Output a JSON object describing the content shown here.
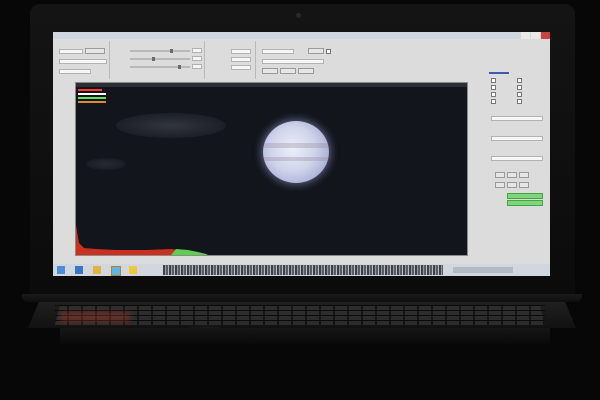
{
  "app": {
    "title": "",
    "window_controls": [
      "minimize",
      "maximize",
      "close"
    ]
  },
  "colors": {
    "stats_red": "#ff3a2a",
    "stats_white": "#ffffff",
    "stats_green": "#5ee35a",
    "histogram_red": "#c9301f",
    "histogram_green": "#5fcf4f",
    "planet": "#cfd4ea",
    "accent_button": "#7ed67a"
  },
  "viewer": {
    "subject": "planet-jupiter"
  },
  "taskbar": {
    "icons": [
      "start-icon",
      "explorer-icon",
      "folder-icon",
      "capture-app-icon",
      "app-icon"
    ]
  }
}
